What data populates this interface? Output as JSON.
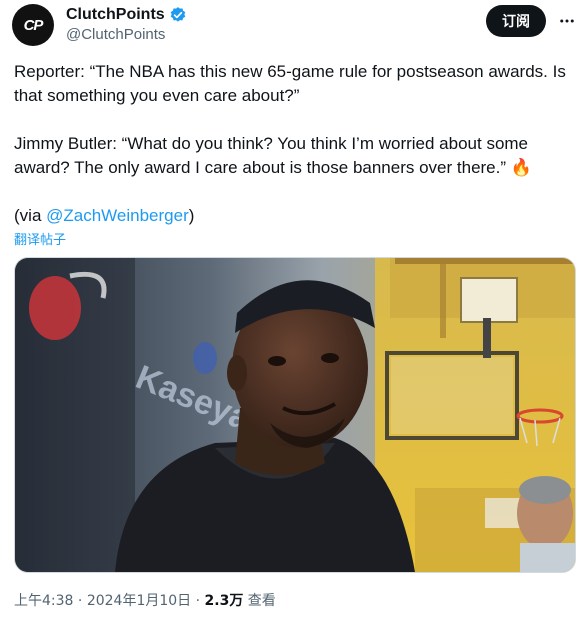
{
  "author": {
    "display_name": "ClutchPoints",
    "handle": "@ClutchPoints",
    "avatar_text": "CP",
    "verified": true
  },
  "subscribe_label": "订阅",
  "tweet": {
    "line1": "Reporter: “The NBA has this new 65-game rule for postseason awards. Is that something you even care about?”",
    "line2": "Jimmy Butler: “What do you think? You think I’m worried about some award? The only award I care about is those banners over there.” 🔥",
    "via_prefix": "(via ",
    "via_link": "@ZachWeinberger",
    "via_suffix": ")",
    "translate_label": "翻译帖子"
  },
  "media": {
    "wall_text": "Kaseya"
  },
  "meta": {
    "time": "上午4:38",
    "sep": " · ",
    "date": "2024年1月10日",
    "views_count": "2.3万",
    "views_label": " 查看"
  },
  "colors": {
    "accent": "#1d9bf0",
    "text": "#0f1419",
    "muted": "#536471",
    "brand_red": "#e2231a"
  }
}
